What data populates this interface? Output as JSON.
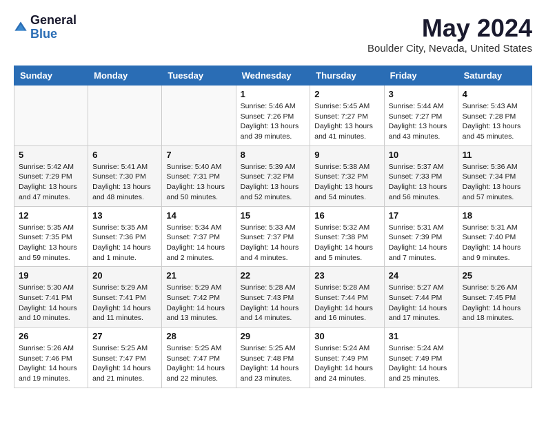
{
  "logo": {
    "general": "General",
    "blue": "Blue"
  },
  "title": "May 2024",
  "location": "Boulder City, Nevada, United States",
  "weekdays": [
    "Sunday",
    "Monday",
    "Tuesday",
    "Wednesday",
    "Thursday",
    "Friday",
    "Saturday"
  ],
  "weeks": [
    [
      {
        "day": "",
        "sunrise": "",
        "sunset": "",
        "daylight": ""
      },
      {
        "day": "",
        "sunrise": "",
        "sunset": "",
        "daylight": ""
      },
      {
        "day": "",
        "sunrise": "",
        "sunset": "",
        "daylight": ""
      },
      {
        "day": "1",
        "sunrise": "Sunrise: 5:46 AM",
        "sunset": "Sunset: 7:26 PM",
        "daylight": "Daylight: 13 hours and 39 minutes."
      },
      {
        "day": "2",
        "sunrise": "Sunrise: 5:45 AM",
        "sunset": "Sunset: 7:27 PM",
        "daylight": "Daylight: 13 hours and 41 minutes."
      },
      {
        "day": "3",
        "sunrise": "Sunrise: 5:44 AM",
        "sunset": "Sunset: 7:27 PM",
        "daylight": "Daylight: 13 hours and 43 minutes."
      },
      {
        "day": "4",
        "sunrise": "Sunrise: 5:43 AM",
        "sunset": "Sunset: 7:28 PM",
        "daylight": "Daylight: 13 hours and 45 minutes."
      }
    ],
    [
      {
        "day": "5",
        "sunrise": "Sunrise: 5:42 AM",
        "sunset": "Sunset: 7:29 PM",
        "daylight": "Daylight: 13 hours and 47 minutes."
      },
      {
        "day": "6",
        "sunrise": "Sunrise: 5:41 AM",
        "sunset": "Sunset: 7:30 PM",
        "daylight": "Daylight: 13 hours and 48 minutes."
      },
      {
        "day": "7",
        "sunrise": "Sunrise: 5:40 AM",
        "sunset": "Sunset: 7:31 PM",
        "daylight": "Daylight: 13 hours and 50 minutes."
      },
      {
        "day": "8",
        "sunrise": "Sunrise: 5:39 AM",
        "sunset": "Sunset: 7:32 PM",
        "daylight": "Daylight: 13 hours and 52 minutes."
      },
      {
        "day": "9",
        "sunrise": "Sunrise: 5:38 AM",
        "sunset": "Sunset: 7:32 PM",
        "daylight": "Daylight: 13 hours and 54 minutes."
      },
      {
        "day": "10",
        "sunrise": "Sunrise: 5:37 AM",
        "sunset": "Sunset: 7:33 PM",
        "daylight": "Daylight: 13 hours and 56 minutes."
      },
      {
        "day": "11",
        "sunrise": "Sunrise: 5:36 AM",
        "sunset": "Sunset: 7:34 PM",
        "daylight": "Daylight: 13 hours and 57 minutes."
      }
    ],
    [
      {
        "day": "12",
        "sunrise": "Sunrise: 5:35 AM",
        "sunset": "Sunset: 7:35 PM",
        "daylight": "Daylight: 13 hours and 59 minutes."
      },
      {
        "day": "13",
        "sunrise": "Sunrise: 5:35 AM",
        "sunset": "Sunset: 7:36 PM",
        "daylight": "Daylight: 14 hours and 1 minute."
      },
      {
        "day": "14",
        "sunrise": "Sunrise: 5:34 AM",
        "sunset": "Sunset: 7:37 PM",
        "daylight": "Daylight: 14 hours and 2 minutes."
      },
      {
        "day": "15",
        "sunrise": "Sunrise: 5:33 AM",
        "sunset": "Sunset: 7:37 PM",
        "daylight": "Daylight: 14 hours and 4 minutes."
      },
      {
        "day": "16",
        "sunrise": "Sunrise: 5:32 AM",
        "sunset": "Sunset: 7:38 PM",
        "daylight": "Daylight: 14 hours and 5 minutes."
      },
      {
        "day": "17",
        "sunrise": "Sunrise: 5:31 AM",
        "sunset": "Sunset: 7:39 PM",
        "daylight": "Daylight: 14 hours and 7 minutes."
      },
      {
        "day": "18",
        "sunrise": "Sunrise: 5:31 AM",
        "sunset": "Sunset: 7:40 PM",
        "daylight": "Daylight: 14 hours and 9 minutes."
      }
    ],
    [
      {
        "day": "19",
        "sunrise": "Sunrise: 5:30 AM",
        "sunset": "Sunset: 7:41 PM",
        "daylight": "Daylight: 14 hours and 10 minutes."
      },
      {
        "day": "20",
        "sunrise": "Sunrise: 5:29 AM",
        "sunset": "Sunset: 7:41 PM",
        "daylight": "Daylight: 14 hours and 11 minutes."
      },
      {
        "day": "21",
        "sunrise": "Sunrise: 5:29 AM",
        "sunset": "Sunset: 7:42 PM",
        "daylight": "Daylight: 14 hours and 13 minutes."
      },
      {
        "day": "22",
        "sunrise": "Sunrise: 5:28 AM",
        "sunset": "Sunset: 7:43 PM",
        "daylight": "Daylight: 14 hours and 14 minutes."
      },
      {
        "day": "23",
        "sunrise": "Sunrise: 5:28 AM",
        "sunset": "Sunset: 7:44 PM",
        "daylight": "Daylight: 14 hours and 16 minutes."
      },
      {
        "day": "24",
        "sunrise": "Sunrise: 5:27 AM",
        "sunset": "Sunset: 7:44 PM",
        "daylight": "Daylight: 14 hours and 17 minutes."
      },
      {
        "day": "25",
        "sunrise": "Sunrise: 5:26 AM",
        "sunset": "Sunset: 7:45 PM",
        "daylight": "Daylight: 14 hours and 18 minutes."
      }
    ],
    [
      {
        "day": "26",
        "sunrise": "Sunrise: 5:26 AM",
        "sunset": "Sunset: 7:46 PM",
        "daylight": "Daylight: 14 hours and 19 minutes."
      },
      {
        "day": "27",
        "sunrise": "Sunrise: 5:25 AM",
        "sunset": "Sunset: 7:47 PM",
        "daylight": "Daylight: 14 hours and 21 minutes."
      },
      {
        "day": "28",
        "sunrise": "Sunrise: 5:25 AM",
        "sunset": "Sunset: 7:47 PM",
        "daylight": "Daylight: 14 hours and 22 minutes."
      },
      {
        "day": "29",
        "sunrise": "Sunrise: 5:25 AM",
        "sunset": "Sunset: 7:48 PM",
        "daylight": "Daylight: 14 hours and 23 minutes."
      },
      {
        "day": "30",
        "sunrise": "Sunrise: 5:24 AM",
        "sunset": "Sunset: 7:49 PM",
        "daylight": "Daylight: 14 hours and 24 minutes."
      },
      {
        "day": "31",
        "sunrise": "Sunrise: 5:24 AM",
        "sunset": "Sunset: 7:49 PM",
        "daylight": "Daylight: 14 hours and 25 minutes."
      },
      {
        "day": "",
        "sunrise": "",
        "sunset": "",
        "daylight": ""
      }
    ]
  ]
}
